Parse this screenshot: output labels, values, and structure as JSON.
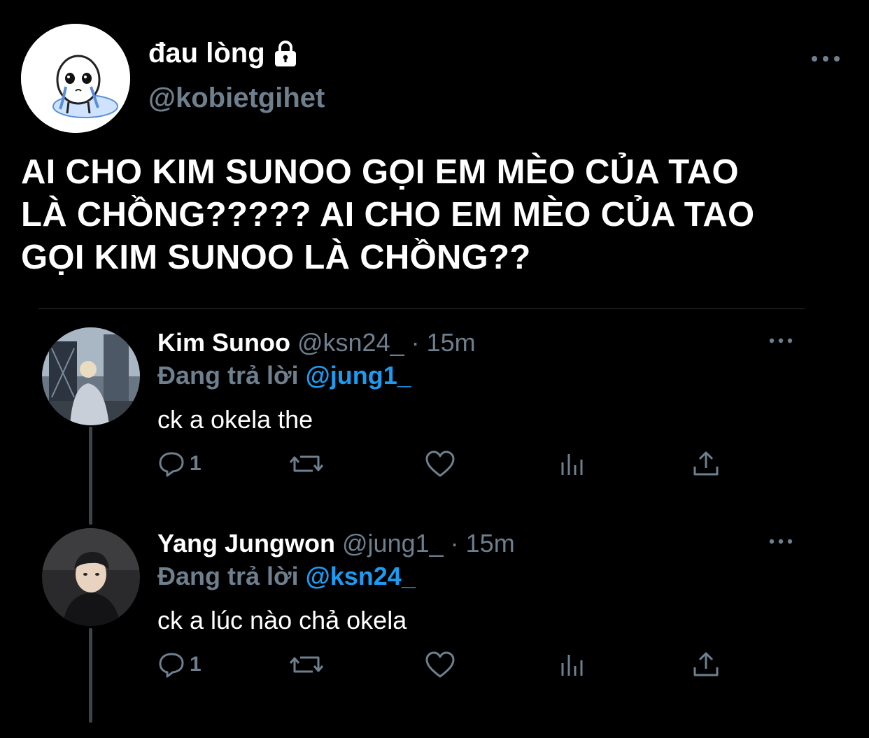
{
  "tweet": {
    "display_name": "đau lòng",
    "handle": "@kobietgihet",
    "text_lines": [
      "AI CHO KIM SUNOO GỌI EM MÈO CỦA TAO",
      "LÀ CHỒNG????? AI CHO EM MÈO CỦA TAO",
      "GỌI KIM SUNOO LÀ CHỒNG??"
    ]
  },
  "replies": [
    {
      "name": "Kim Sunoo",
      "meta": "@ksn24_ · 15m",
      "replying_label": "Đang trả lời",
      "replying_to": "@jung1_",
      "text": "ck a okela the",
      "reply_count": "1"
    },
    {
      "name": "Yang Jungwon",
      "meta": "@jung1_ · 15m",
      "replying_label": "Đang trả lời",
      "replying_to": "@ksn24_",
      "text": "ck a lúc nào chả okela",
      "reply_count": "1"
    }
  ],
  "icons": {
    "lock": "lock-icon",
    "more": "more-icon",
    "reply": "reply-icon",
    "retweet": "retweet-icon",
    "like": "heart-icon",
    "views": "views-icon",
    "share": "share-icon"
  },
  "colors": {
    "background": "#000000",
    "text": "#ffffff",
    "secondary": "#6e7f8e",
    "accent": "#1d9bf0"
  }
}
